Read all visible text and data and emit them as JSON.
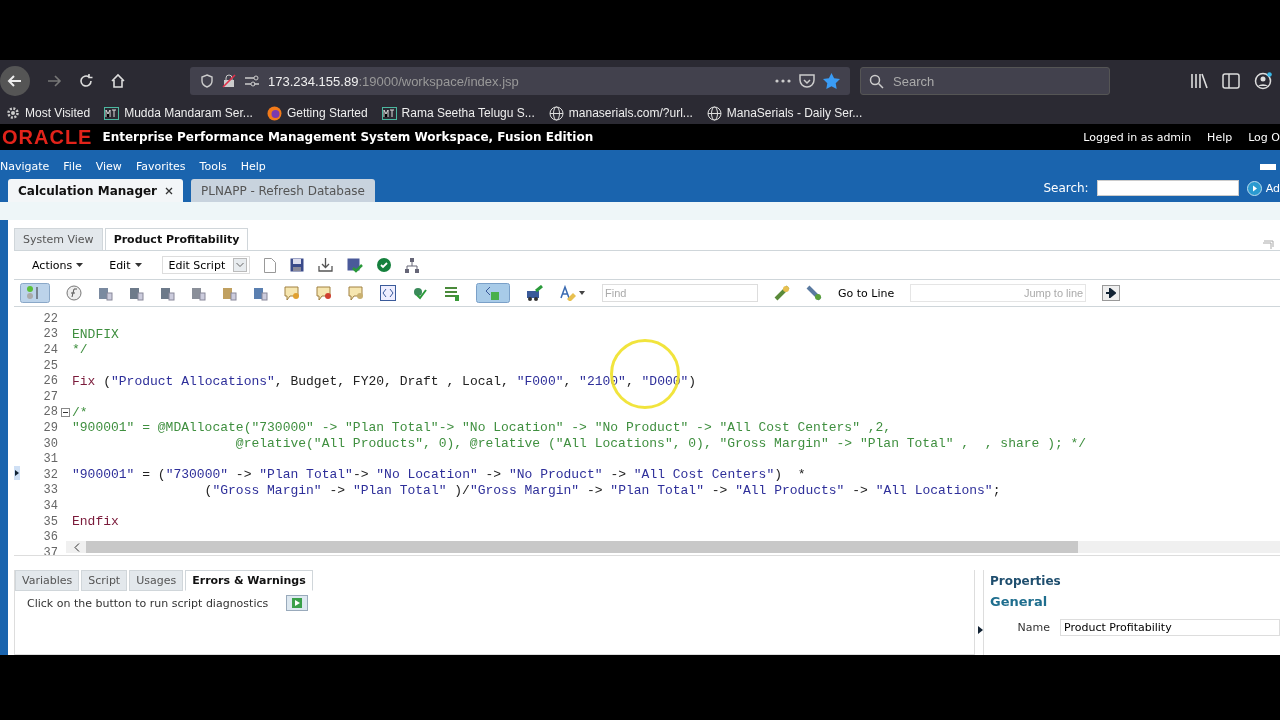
{
  "browser": {
    "url_host": "173.234.155.89",
    "url_path": ":19000/workspace/index.jsp",
    "search_placeholder": "Search",
    "bookmarks": [
      {
        "kind": "gear",
        "label": "Most Visited"
      },
      {
        "kind": "mtm",
        "label": "Mudda Mandaram Ser..."
      },
      {
        "kind": "firefox",
        "label": "Getting Started"
      },
      {
        "kind": "mtm",
        "label": "Rama Seetha Telugu S..."
      },
      {
        "kind": "globe",
        "label": "manaserials.com/?url..."
      },
      {
        "kind": "globe",
        "label": "ManaSerials - Daily Ser..."
      }
    ]
  },
  "header": {
    "logo": "ORACLE",
    "title": "Enterprise Performance Management System Workspace, Fusion Edition",
    "links": [
      "Logged in as admin",
      "Help",
      "Log O"
    ]
  },
  "menu": [
    "Navigate",
    "File",
    "View",
    "Favorites",
    "Tools",
    "Help"
  ],
  "tabs": [
    {
      "label": "Calculation Manager",
      "selected": true,
      "closable": true
    },
    {
      "label": "PLNAPP - Refresh Database",
      "selected": false,
      "closable": false
    }
  ],
  "search": {
    "label": "Search:",
    "cut_text": "Ad"
  },
  "view_tabs": [
    {
      "label": "System View",
      "selected": false
    },
    {
      "label": "Product Profitability",
      "selected": true
    }
  ],
  "toolbar": {
    "menus": [
      "Actions",
      "Edit"
    ],
    "mode": "Edit Script",
    "find_placeholder": "Find",
    "goto_label": "Go to Line",
    "jump_placeholder": "Jump to line"
  },
  "code": [
    {
      "number": "22"
    },
    {
      "number": "23",
      "segments": [
        {
          "kind": "comment",
          "text": "ENDFIX"
        }
      ]
    },
    {
      "number": "24",
      "segments": [
        {
          "kind": "comment",
          "text": "*/"
        }
      ]
    },
    {
      "number": "25"
    },
    {
      "number": "26",
      "segments": [
        {
          "kind": "keyword",
          "text": "Fix"
        },
        {
          "kind": "plain",
          "text": " ("
        },
        {
          "kind": "string",
          "text": "\"Product Allocations\""
        },
        {
          "kind": "plain",
          "text": ", Budget, FY20, Draft , Local, "
        },
        {
          "kind": "string",
          "text": "\"F000\""
        },
        {
          "kind": "plain",
          "text": ", "
        },
        {
          "kind": "string",
          "text": "\"2100\""
        },
        {
          "kind": "plain",
          "text": ", "
        },
        {
          "kind": "string",
          "text": "\"D000\""
        },
        {
          "kind": "plain",
          "text": ")"
        }
      ]
    },
    {
      "number": "27"
    },
    {
      "number": "28",
      "fold": true,
      "segments": [
        {
          "kind": "comment",
          "text": "/*"
        }
      ]
    },
    {
      "number": "29",
      "segments": [
        {
          "kind": "comment",
          "text": "\"900001\" = @MDAllocate(\"730000\" -> \"Plan Total\"-> \"No Location\" -> \"No Product\" -> \"All Cost Centers\" ,2,"
        }
      ]
    },
    {
      "number": "30",
      "segments": [
        {
          "kind": "comment",
          "text": "                     @relative(\"All Products\", 0), @relative (\"All Locations\", 0), \"Gross Margin\" -> \"Plan Total\" ,  , share ); */"
        }
      ]
    },
    {
      "number": "31"
    },
    {
      "number": "32",
      "marker": true,
      "segments": [
        {
          "kind": "string",
          "text": "\"900001\""
        },
        {
          "kind": "plain",
          "text": " = ("
        },
        {
          "kind": "string",
          "text": "\"730000\""
        },
        {
          "kind": "plain",
          "text": " -> "
        },
        {
          "kind": "string",
          "text": "\"Plan Total\""
        },
        {
          "kind": "plain",
          "text": "-> "
        },
        {
          "kind": "string",
          "text": "\"No Location\""
        },
        {
          "kind": "plain",
          "text": " -> "
        },
        {
          "kind": "string",
          "text": "\"No Product\""
        },
        {
          "kind": "plain",
          "text": " -> "
        },
        {
          "kind": "string",
          "text": "\"All Cost Centers\""
        },
        {
          "kind": "plain",
          "text": ")  *"
        }
      ]
    },
    {
      "number": "33",
      "segments": [
        {
          "kind": "plain",
          "text": "                 ("
        },
        {
          "kind": "string",
          "text": "\"Gross Margin\""
        },
        {
          "kind": "plain",
          "text": " -> "
        },
        {
          "kind": "string",
          "text": "\"Plan Total\""
        },
        {
          "kind": "plain",
          "text": " )/"
        },
        {
          "kind": "string",
          "text": "\"Gross Margin\""
        },
        {
          "kind": "plain",
          "text": " -> "
        },
        {
          "kind": "string",
          "text": "\"Plan Total\""
        },
        {
          "kind": "plain",
          "text": " -> "
        },
        {
          "kind": "string",
          "text": "\"All Products\""
        },
        {
          "kind": "plain",
          "text": " -> "
        },
        {
          "kind": "string",
          "text": "\"All Locations\""
        },
        {
          "kind": "plain",
          "text": ";"
        }
      ]
    },
    {
      "number": "34"
    },
    {
      "number": "35",
      "segments": [
        {
          "kind": "keyword",
          "text": "Endfix"
        }
      ]
    },
    {
      "number": "36"
    },
    {
      "number": "37"
    }
  ],
  "bottom_tabs": [
    {
      "label": "Variables",
      "selected": false
    },
    {
      "label": "Script",
      "selected": false
    },
    {
      "label": "Usages",
      "selected": false
    },
    {
      "label": "Errors & Warnings",
      "selected": true
    }
  ],
  "diagnostics_message": "Click on the button to run script diagnostics",
  "properties": {
    "title": "Properties",
    "section": "General",
    "fields": [
      {
        "label": "Name",
        "value": "Product Profitability"
      }
    ]
  }
}
